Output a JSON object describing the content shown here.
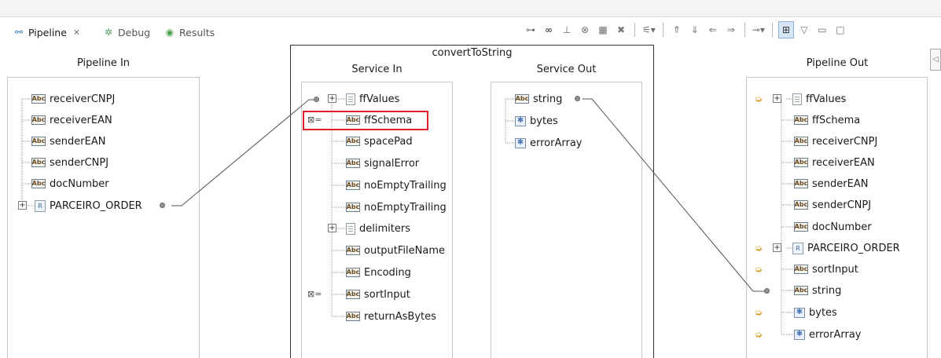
{
  "tabs": [
    {
      "label": "Pipeline",
      "close": "✕"
    },
    {
      "label": "Debug"
    },
    {
      "label": "Results"
    }
  ],
  "pipeline_in": {
    "title": "Pipeline In",
    "items": [
      "receiverCNPJ",
      "receiverEAN",
      "senderEAN",
      "senderCNPJ",
      "docNumber",
      "PARCEIRO_ORDER"
    ]
  },
  "service": {
    "title": "convertToString",
    "in_title": "Service In",
    "out_title": "Service Out",
    "in_items": [
      "ffValues",
      "ffSchema",
      "spacePad",
      "signalError",
      "noEmptyTrailing",
      "noEmptyTrailing",
      "delimiters",
      "outputFileName",
      "Encoding",
      "sortInput",
      "returnAsBytes"
    ],
    "out_items": [
      "string",
      "bytes",
      "errorArray"
    ]
  },
  "pipeline_out": {
    "title": "Pipeline Out",
    "items": [
      "ffValues",
      "ffSchema",
      "receiverCNPJ",
      "receiverEAN",
      "senderEAN",
      "senderCNPJ",
      "docNumber",
      "PARCEIRO_ORDER",
      "sortInput",
      "string",
      "bytes",
      "errorArray"
    ]
  },
  "icons": {
    "abc_label": "Abc",
    "map_set": "⊠=",
    "plus": "+"
  },
  "colors": {
    "highlight": "#e0202a",
    "selected_tool": "#d7e6f6"
  }
}
